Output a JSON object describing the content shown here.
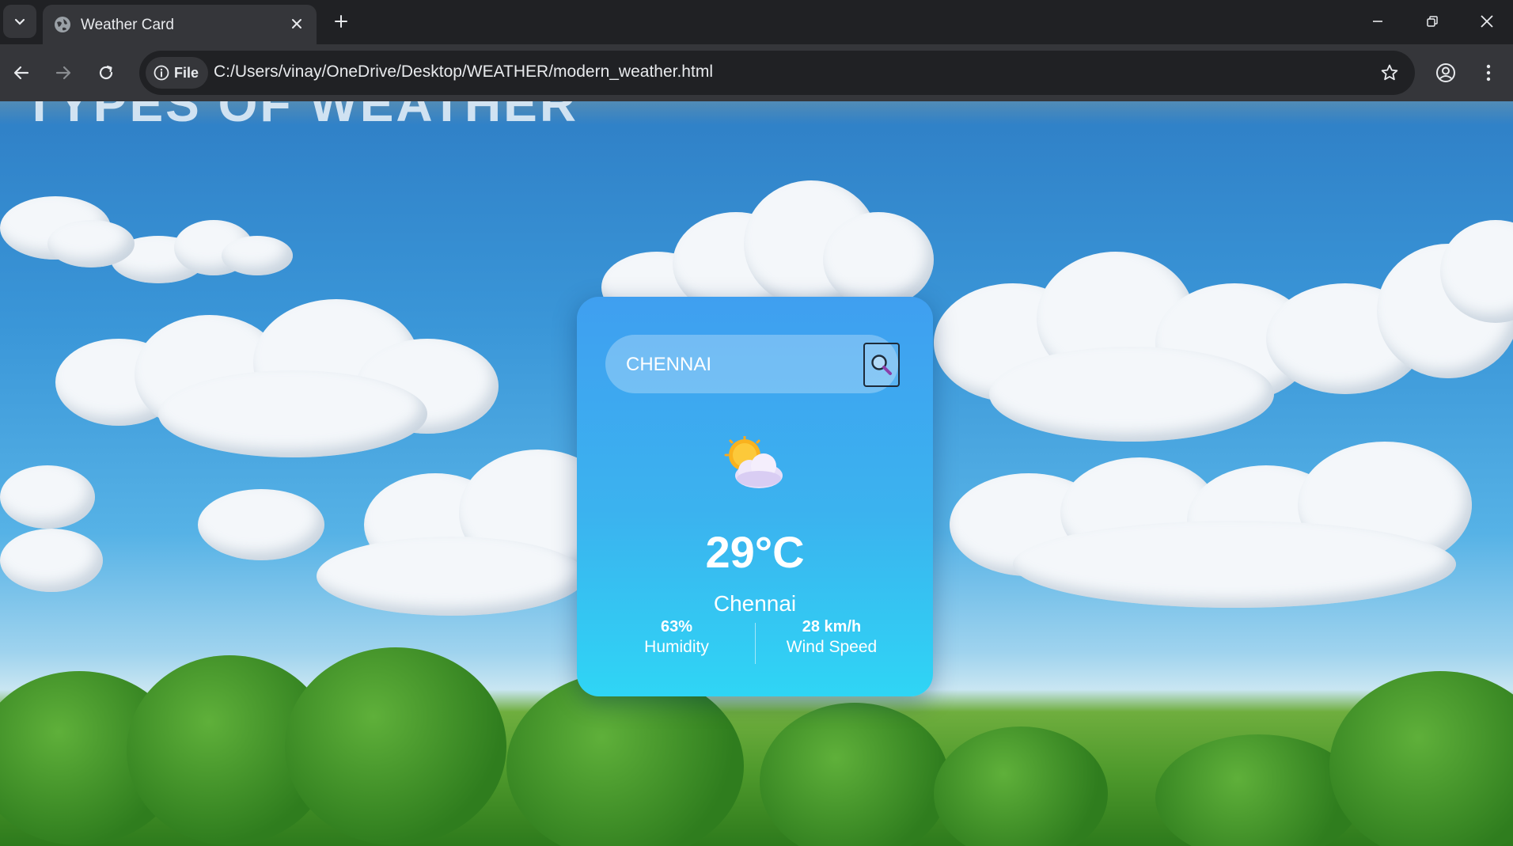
{
  "browser": {
    "tab_title": "Weather Card",
    "site_chip": "File",
    "url": "C:/Users/vinay/OneDrive/Desktop/WEATHER/modern_weather.html"
  },
  "page": {
    "background_title": "TYPES OF WEATHER"
  },
  "weather": {
    "search_value": "CHENNAI",
    "icon": "sun-behind-cloud-icon",
    "temperature": "29°C",
    "city": "Chennai",
    "humidity_value": "63%",
    "humidity_label": "Humidity",
    "wind_value": "28 km/h",
    "wind_label": "Wind Speed"
  },
  "colors": {
    "card_top": "#3f9ff0",
    "card_bottom": "#2fd5f5",
    "chrome_dark": "#202124",
    "chrome_light": "#35363a"
  }
}
